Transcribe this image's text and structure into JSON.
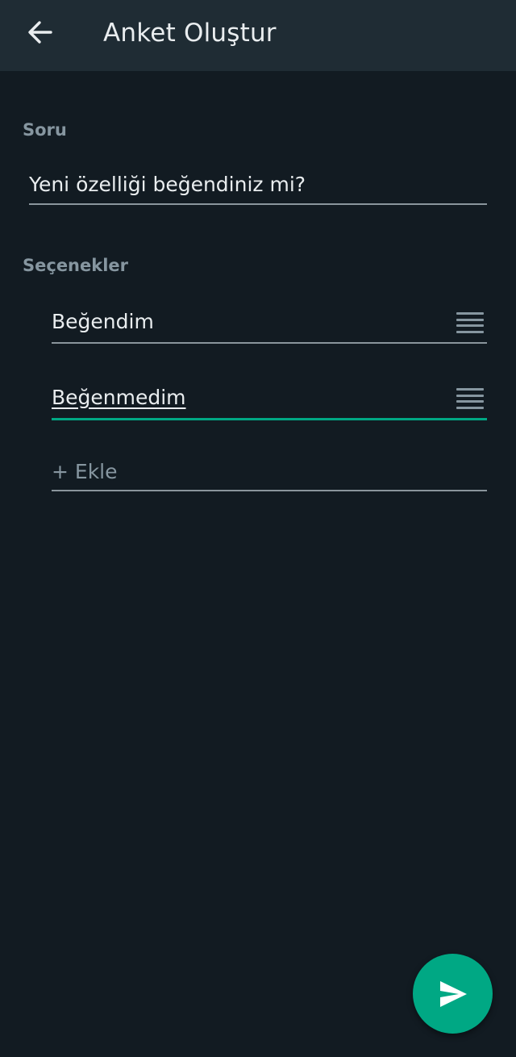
{
  "header": {
    "title": "Anket Oluştur",
    "back_icon": "arrow-left-icon"
  },
  "question": {
    "label": "Soru",
    "value": "Yeni özelliği beğendiniz mi?"
  },
  "options": {
    "label": "Seçenekler",
    "items": [
      {
        "value": "Beğendim",
        "focused": false
      },
      {
        "value": "Beğenmedim",
        "focused": true
      }
    ],
    "add_placeholder": "+ Ekle"
  },
  "fab": {
    "icon": "send-icon"
  },
  "colors": {
    "background": "#121b22",
    "appbar": "#1f2c34",
    "accent": "#00a884",
    "label": "#8696a0"
  }
}
